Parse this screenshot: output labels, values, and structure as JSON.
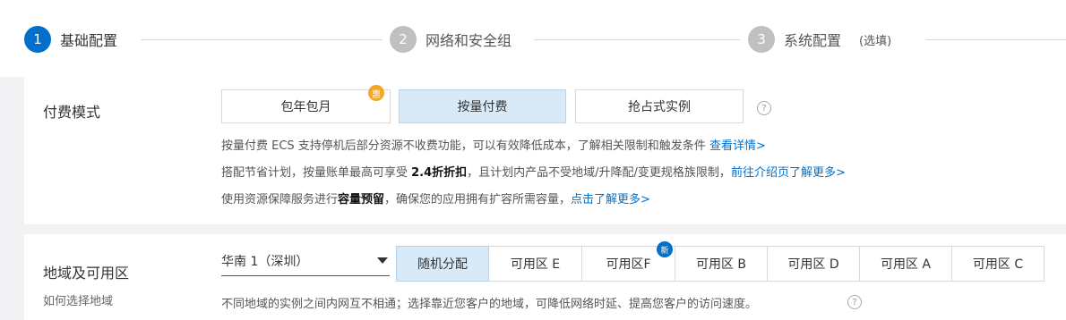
{
  "steps": [
    {
      "num": "1",
      "label": "基础配置"
    },
    {
      "num": "2",
      "label": "网络和安全组"
    },
    {
      "num": "3",
      "label": "系统配置",
      "optional": "(选填)"
    }
  ],
  "billing": {
    "label": "付费模式",
    "options": [
      "包年包月",
      "按量付费",
      "抢占式实例"
    ],
    "promo_badge": "惠",
    "help": "?",
    "line1_text": "按量付费 ECS 支持停机后部分资源不收费功能，可以有效降低成本，了解相关限制和触发条件 ",
    "line1_link": "查看详情>",
    "line2_pre": "搭配节省计划，按量账单最高可享受 ",
    "line2_bold": "2.4折折扣",
    "line2_post": "，且计划内产品不受地域/升降配/变更规格族限制，",
    "line2_link": "前往介绍页了解更多>",
    "line3_pre": "使用资源保障服务进行",
    "line3_bold": "容量预留",
    "line3_post": "，确保您的应用拥有扩容所需容量，",
    "line3_link": "点击了解更多>"
  },
  "region": {
    "label": "地域及可用区",
    "sublabel": "如何选择地域",
    "selected_region": "华南 1（深圳）",
    "zones": [
      "随机分配",
      "可用区 E",
      "可用区F",
      "可用区 B",
      "可用区 D",
      "可用区 A",
      "可用区 C"
    ],
    "new_badge": "新",
    "note": "不同地域的实例之间内网互不相通；选择靠近您客户的地域，可降低网络时延、提高您客户的访问速度。",
    "help": "?"
  },
  "colors": {
    "accent": "#0070cc",
    "selected_bg": "#d8eaf7",
    "promo": "#f5a623"
  }
}
